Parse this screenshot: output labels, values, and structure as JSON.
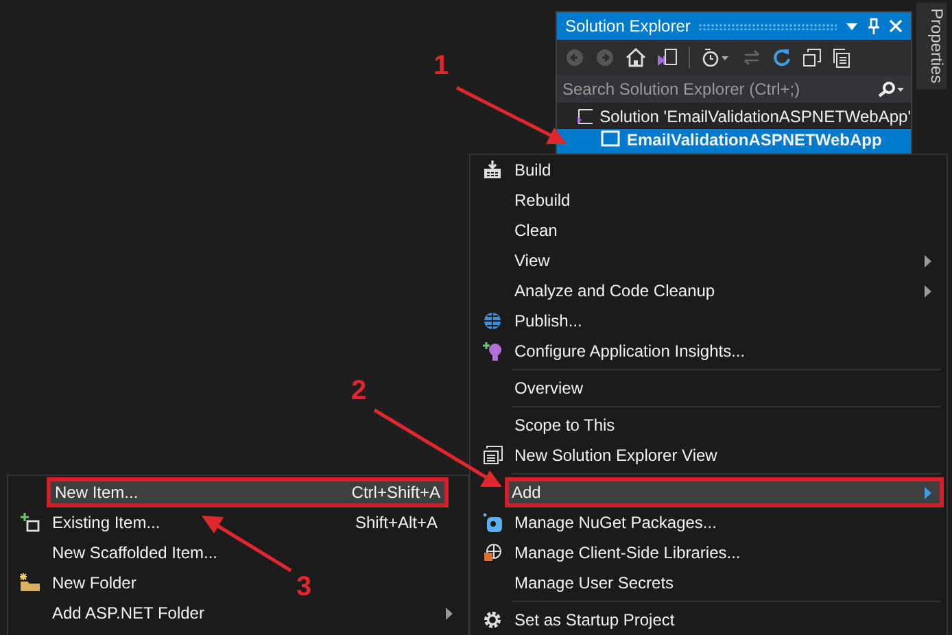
{
  "solution_explorer": {
    "title": "Solution Explorer",
    "search": {
      "placeholder": "Search Solution Explorer (Ctrl+;)"
    },
    "tree": [
      {
        "label": "Solution 'EmailValidationASPNETWebApp'",
        "selected": false,
        "children": [
          {
            "label": "EmailValidationASPNETWebApp",
            "selected": true
          }
        ]
      }
    ]
  },
  "properties_tab": {
    "label": "Properties"
  },
  "context_menu": {
    "items": [
      {
        "kind": "item",
        "label": "Build",
        "submenu": false,
        "selected": false,
        "highlighted": false
      },
      {
        "kind": "item",
        "label": "Rebuild",
        "submenu": false,
        "selected": false,
        "highlighted": false
      },
      {
        "kind": "item",
        "label": "Clean",
        "submenu": false,
        "selected": false,
        "highlighted": false
      },
      {
        "kind": "item",
        "label": "View",
        "submenu": true,
        "selected": false,
        "highlighted": false
      },
      {
        "kind": "item",
        "label": "Analyze and Code Cleanup",
        "submenu": true,
        "selected": false,
        "highlighted": false
      },
      {
        "kind": "item",
        "label": "Publish...",
        "submenu": false,
        "selected": false,
        "highlighted": false
      },
      {
        "kind": "item",
        "label": "Configure Application Insights...",
        "submenu": false,
        "selected": false,
        "highlighted": false
      },
      {
        "kind": "separator"
      },
      {
        "kind": "item",
        "label": "Overview",
        "submenu": false,
        "selected": false,
        "highlighted": false
      },
      {
        "kind": "separator"
      },
      {
        "kind": "item",
        "label": "Scope to This",
        "submenu": false,
        "selected": false,
        "highlighted": false
      },
      {
        "kind": "item",
        "label": "New Solution Explorer View",
        "submenu": false,
        "selected": false,
        "highlighted": false
      },
      {
        "kind": "separator"
      },
      {
        "kind": "item",
        "label": "Add",
        "submenu": true,
        "selected": true,
        "highlighted": true
      },
      {
        "kind": "item",
        "label": "Manage NuGet Packages...",
        "submenu": false,
        "selected": false,
        "highlighted": false
      },
      {
        "kind": "item",
        "label": "Manage Client-Side Libraries...",
        "submenu": false,
        "selected": false,
        "highlighted": false
      },
      {
        "kind": "item",
        "label": "Manage User Secrets",
        "submenu": false,
        "selected": false,
        "highlighted": false
      },
      {
        "kind": "separator"
      },
      {
        "kind": "item",
        "label": "Set as Startup Project",
        "submenu": false,
        "selected": false,
        "highlighted": false
      }
    ]
  },
  "add_submenu": {
    "items": [
      {
        "label": "New Item...",
        "shortcut": "Ctrl+Shift+A",
        "submenu": false,
        "selected": true,
        "highlighted": true
      },
      {
        "label": "Existing Item...",
        "shortcut": "Shift+Alt+A",
        "submenu": false,
        "selected": false,
        "highlighted": false
      },
      {
        "label": "New Scaffolded Item...",
        "submenu": false,
        "selected": false,
        "highlighted": false
      },
      {
        "label": "New Folder",
        "submenu": false,
        "selected": false,
        "highlighted": false
      },
      {
        "label": "Add ASP.NET Folder",
        "submenu": true,
        "selected": false,
        "highlighted": false
      }
    ]
  },
  "annotations": [
    {
      "label": "1"
    },
    {
      "label": "2"
    },
    {
      "label": "3"
    }
  ]
}
